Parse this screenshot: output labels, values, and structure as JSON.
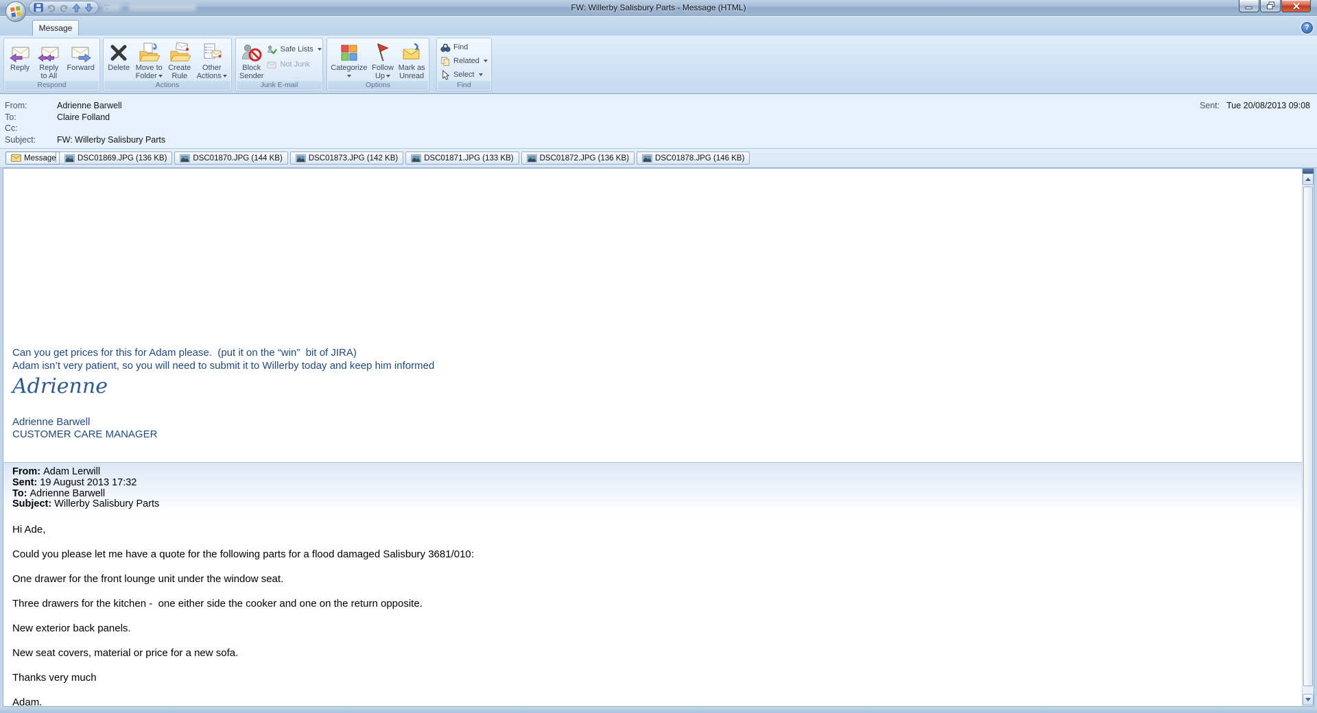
{
  "window": {
    "title": "FW: Willerby Salisbury Parts - Message (HTML)",
    "help": "?"
  },
  "tabs": {
    "message": "Message"
  },
  "ribbon": {
    "respond": {
      "group": "Respond",
      "reply": [
        "Reply"
      ],
      "reply_all": [
        "Reply",
        "to All"
      ],
      "forward": [
        "Forward"
      ]
    },
    "actions": {
      "group": "Actions",
      "delete": [
        "Delete"
      ],
      "move": [
        "Move to",
        "Folder"
      ],
      "rule": [
        "Create",
        "Rule"
      ],
      "other": [
        "Other",
        "Actions"
      ]
    },
    "junk": {
      "group": "Junk E-mail",
      "block": [
        "Block",
        "Sender"
      ],
      "safe": [
        "Safe Lists"
      ],
      "notjunk": [
        "Not Junk"
      ]
    },
    "options": {
      "group": "Options",
      "categorize": [
        "Categorize"
      ],
      "follow": [
        "Follow",
        "Up"
      ],
      "unread": [
        "Mark as",
        "Unread"
      ]
    },
    "find": {
      "group": "Find",
      "find": [
        "Find"
      ],
      "related": [
        "Related"
      ],
      "select": [
        "Select"
      ]
    }
  },
  "icons": {
    "office_button": "office-orb",
    "qat": [
      "save",
      "undo",
      "redo",
      "previous-item",
      "next-item",
      "customize-quick-access"
    ],
    "reply": "envelope-purple-arrow-left",
    "reply_all": "envelope-two-purple-arrows",
    "forward": "envelope-blue-arrow-right",
    "delete": "black-x",
    "move_to_folder": "folder-with-blue-arrow",
    "create_rule": "folder-with-envelope",
    "other_actions": "document-with-envelope",
    "block_sender": "person-with-no-symbol",
    "safe_lists": "person-with-green-check",
    "not_junk": "gray-envelope",
    "categorize": "four-color-squares",
    "follow_up": "red-flag",
    "mark_as_unread": "envelope-with-blue-arrow",
    "find": "binoculars",
    "related": "stacked-documents",
    "select": "cursor-arrow",
    "attachment": "photo-thumbnail",
    "message_tab": "yellow-envelope"
  },
  "header": {
    "from_label": "From:",
    "from": "Adrienne Barwell",
    "to_label": "To:",
    "to": "Claire Folland",
    "cc_label": "Cc:",
    "cc": "",
    "subject_label": "Subject:",
    "subject": "FW: Willerby Salisbury Parts",
    "sent_label": "Sent:",
    "sent": "Tue 20/08/2013 09:08"
  },
  "attachments": {
    "message_tab": "Message",
    "files": [
      "DSC01869.JPG (136 KB)",
      "DSC01870.JPG (144 KB)",
      "DSC01873.JPG (142 KB)",
      "DSC01871.JPG (133 KB)",
      "DSC01872.JPG (136 KB)",
      "DSC01878.JPG (146 KB)"
    ]
  },
  "body": {
    "intro1": "Can you get prices for this for Adam please.  (put it on the “win”  bit of JIRA)",
    "intro2": "Adam isn’t very patient, so you will need to submit it to Willerby today and keep him informed",
    "script_signature": "Adrienne",
    "sig_name": "Adrienne Barwell",
    "sig_title": "CUSTOMER CARE MANAGER",
    "q_from_label": "From:",
    "q_from": "Adam Lerwill",
    "q_sent_label": "Sent:",
    "q_sent": "19 August 2013 17:32",
    "q_to_label": "To:",
    "q_to": "Adrienne Barwell",
    "q_subject_label": "Subject:",
    "q_subject": "Willerby Salisbury Parts",
    "paragraphs": [
      "Hi Ade,",
      "Could you please let me have a quote for the following parts for a flood damaged Salisbury 3681/010:",
      "One drawer for the front lounge unit under the window seat.",
      "Three drawers for the kitchen -  one either side the cooker and one on the return opposite.",
      "New exterior back panels.",
      "New seat covers, material or price for a new sofa.",
      "Thanks very much",
      "Adam."
    ]
  }
}
